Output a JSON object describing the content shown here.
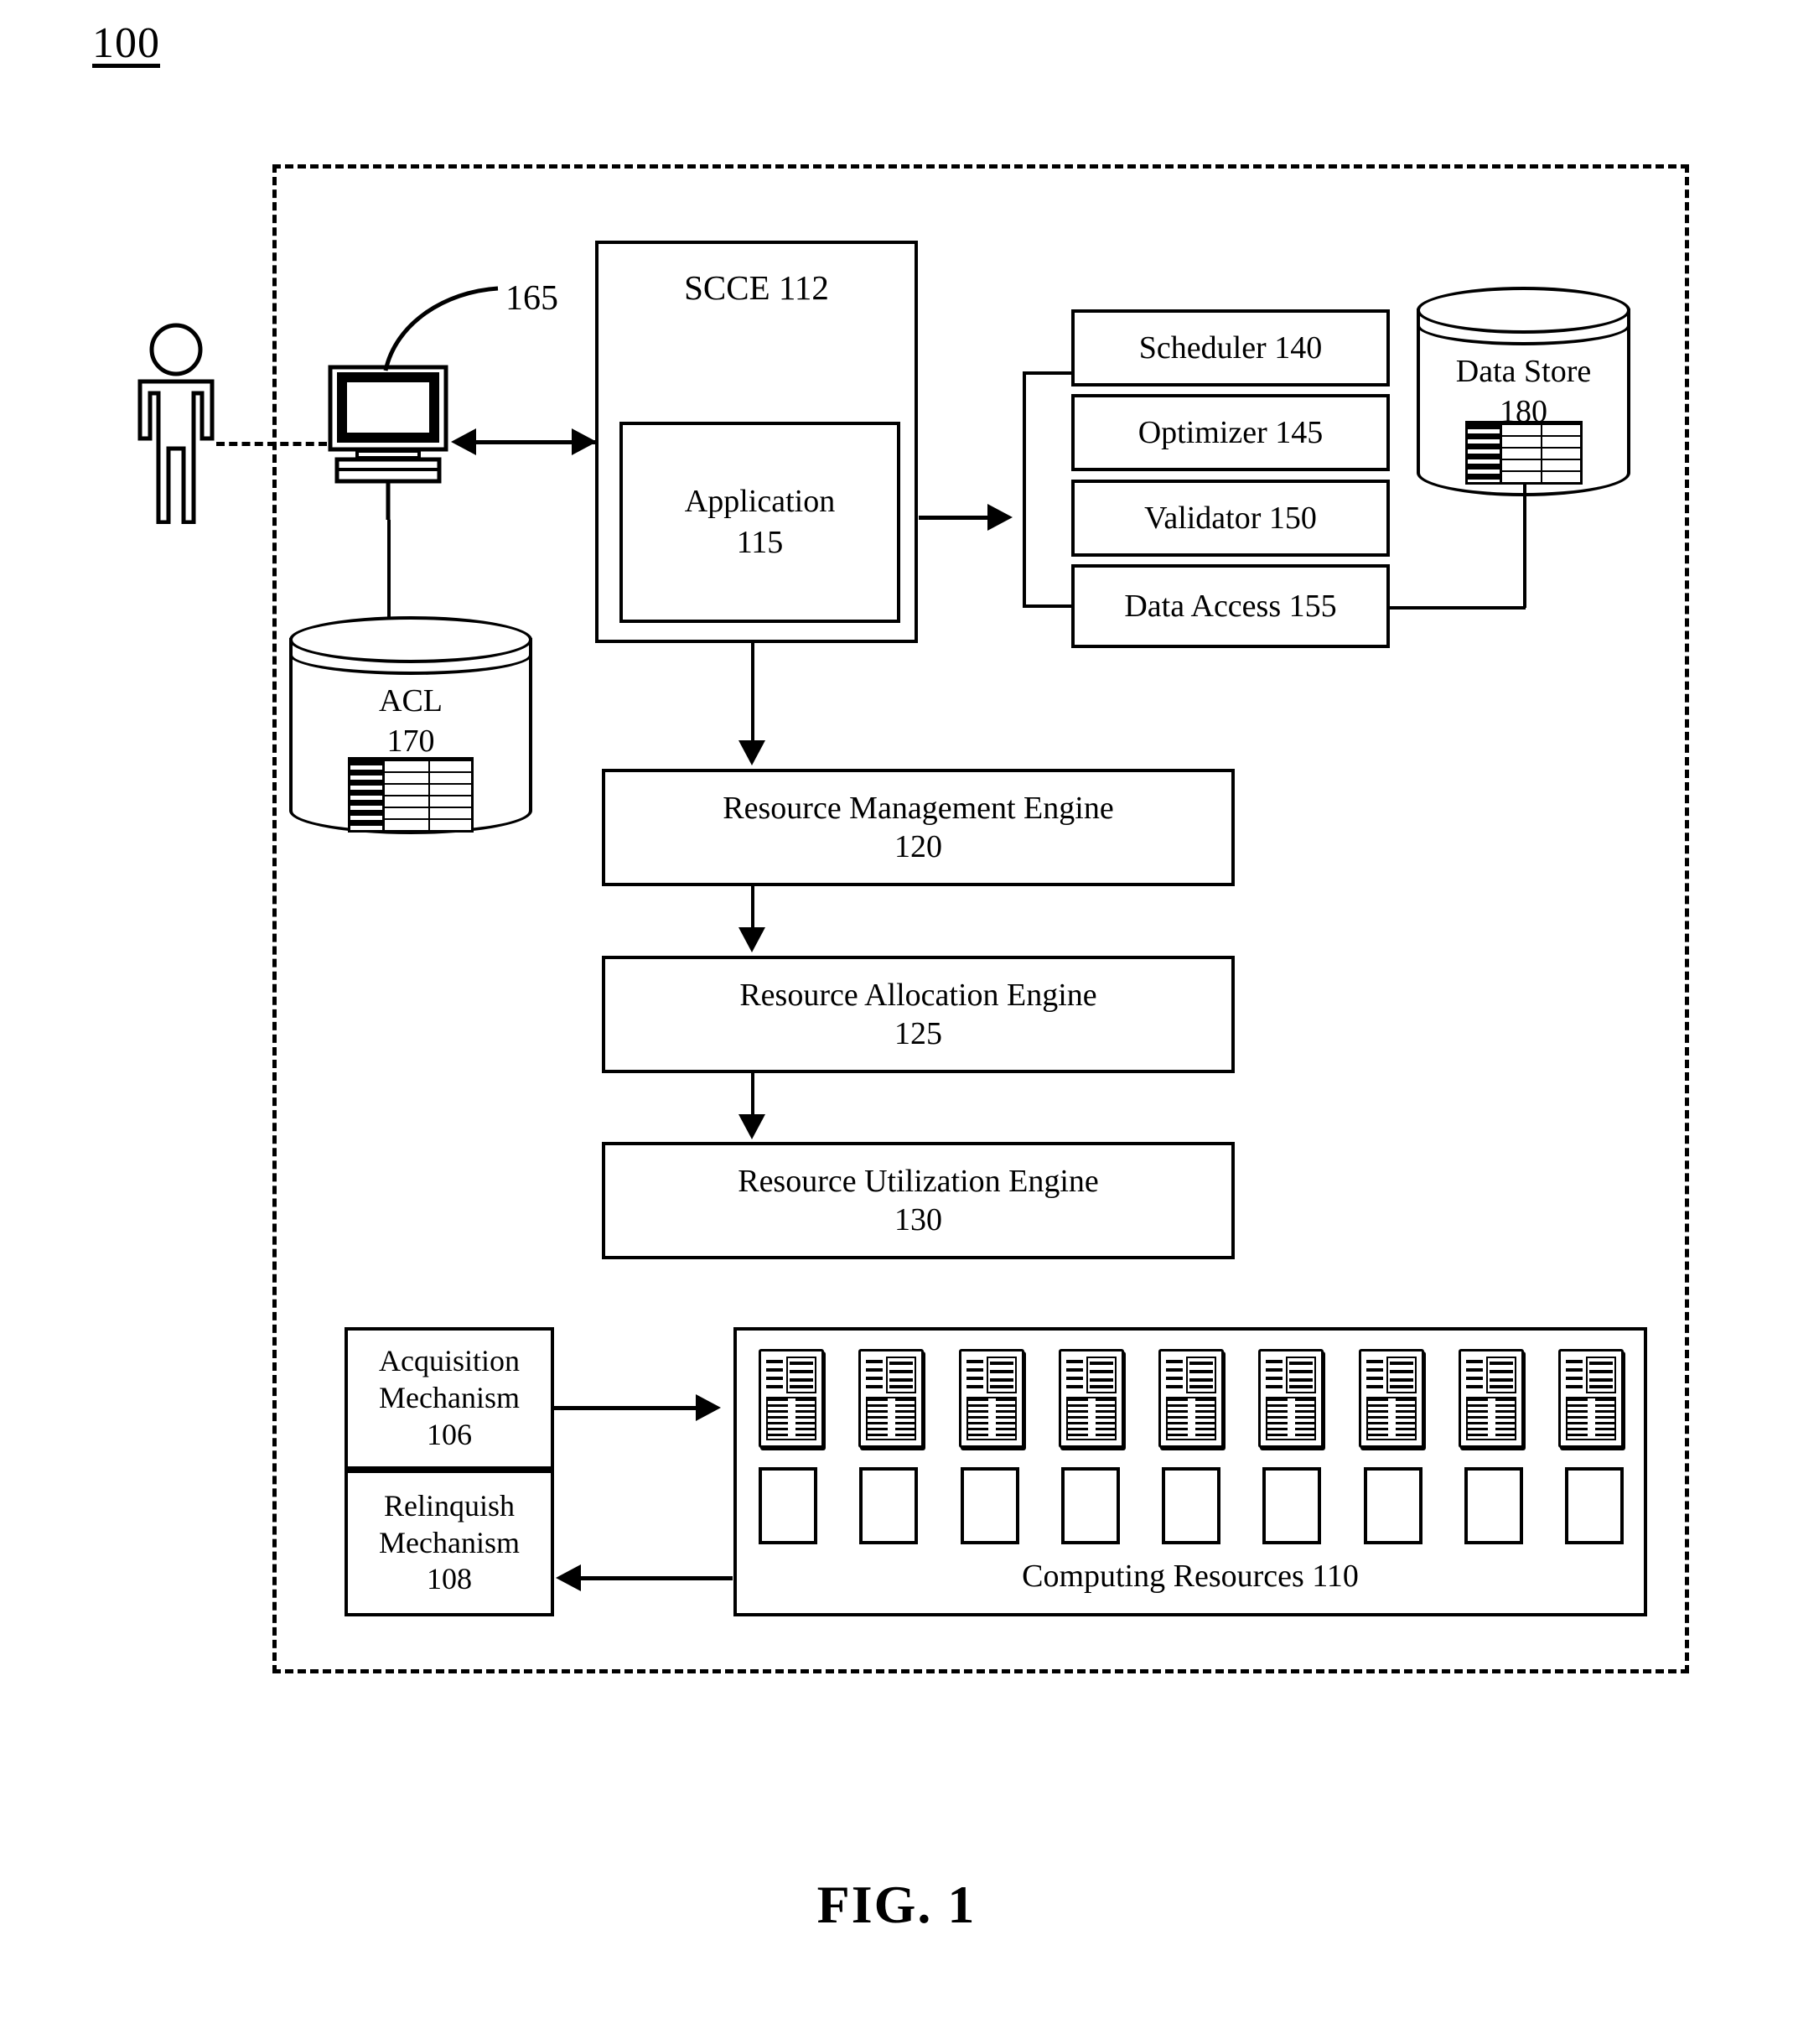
{
  "figure": {
    "number": "100",
    "caption": "FIG. 1"
  },
  "callouts": {
    "leader_165": "165"
  },
  "actor": {
    "name": "user-stick-figure"
  },
  "workstation": {
    "name": "client-computer"
  },
  "scce": {
    "title": "SCCE 112",
    "application": {
      "line1": "Application",
      "line2": "115"
    }
  },
  "modules": [
    {
      "label": "Scheduler 140",
      "id": "scheduler"
    },
    {
      "label": "Optimizer 145",
      "id": "optimizer"
    },
    {
      "label": "Validator 150",
      "id": "validator"
    },
    {
      "label": "Data Access 155",
      "id": "data-access"
    }
  ],
  "engines": [
    {
      "line1": "Resource Management Engine",
      "line2": "120",
      "id": "management"
    },
    {
      "line1": "Resource Allocation Engine",
      "line2": "125",
      "id": "allocation"
    },
    {
      "line1": "Resource Utilization Engine",
      "line2": "130",
      "id": "utilization"
    }
  ],
  "mechanisms": [
    {
      "line1": "Acquisition",
      "line2": "Mechanism",
      "line3": "106",
      "id": "acquisition"
    },
    {
      "line1": "Relinquish",
      "line2": "Mechanism",
      "line3": "108",
      "id": "relinquish"
    }
  ],
  "data_stores": [
    {
      "line1": "ACL",
      "line2": "170",
      "id": "acl"
    },
    {
      "line1": "Data Store",
      "line2": "180",
      "id": "data-store"
    }
  ],
  "computing_resources": {
    "label": "Computing Resources 110",
    "server_count": 9,
    "blank_count": 9
  },
  "colors": {
    "stroke": "#000000",
    "background": "#ffffff"
  }
}
